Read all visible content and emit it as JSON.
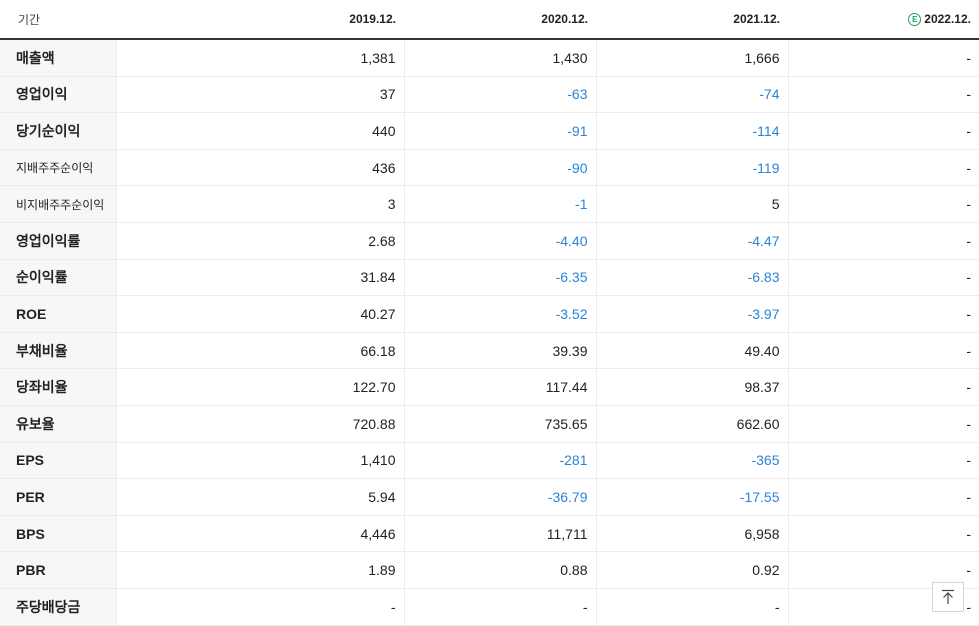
{
  "header": {
    "period_label": "기간",
    "columns": [
      "2019.12.",
      "2020.12.",
      "2021.12.",
      "2022.12."
    ],
    "estimate_marker": "E"
  },
  "colors": {
    "negative": "#2a84d8",
    "estimate": "#1aa260"
  },
  "rows": [
    {
      "label": "매출액",
      "values": [
        "1,381",
        "1,430",
        "1,666",
        "-"
      ]
    },
    {
      "label": "영업이익",
      "values": [
        "37",
        "-63",
        "-74",
        "-"
      ]
    },
    {
      "label": "당기순이익",
      "values": [
        "440",
        "-91",
        "-114",
        "-"
      ]
    },
    {
      "label": "지배주주순이익",
      "values": [
        "436",
        "-90",
        "-119",
        "-"
      ]
    },
    {
      "label": "비지배주주순이익",
      "values": [
        "3",
        "-1",
        "5",
        "-"
      ]
    },
    {
      "label": "영업이익률",
      "values": [
        "2.68",
        "-4.40",
        "-4.47",
        "-"
      ]
    },
    {
      "label": "순이익률",
      "values": [
        "31.84",
        "-6.35",
        "-6.83",
        "-"
      ]
    },
    {
      "label": "ROE",
      "values": [
        "40.27",
        "-3.52",
        "-3.97",
        "-"
      ]
    },
    {
      "label": "부채비율",
      "values": [
        "66.18",
        "39.39",
        "49.40",
        "-"
      ]
    },
    {
      "label": "당좌비율",
      "values": [
        "122.70",
        "117.44",
        "98.37",
        "-"
      ]
    },
    {
      "label": "유보율",
      "values": [
        "720.88",
        "735.65",
        "662.60",
        "-"
      ]
    },
    {
      "label": "EPS",
      "values": [
        "1,410",
        "-281",
        "-365",
        "-"
      ]
    },
    {
      "label": "PER",
      "values": [
        "5.94",
        "-36.79",
        "-17.55",
        "-"
      ]
    },
    {
      "label": "BPS",
      "values": [
        "4,446",
        "11,711",
        "6,958",
        "-"
      ]
    },
    {
      "label": "PBR",
      "values": [
        "1.89",
        "0.88",
        "0.92",
        "-"
      ]
    },
    {
      "label": "주당배당금",
      "values": [
        "-",
        "-",
        "-",
        "-"
      ]
    }
  ],
  "scroll_top_icon": "arrow-up-to-top-icon"
}
